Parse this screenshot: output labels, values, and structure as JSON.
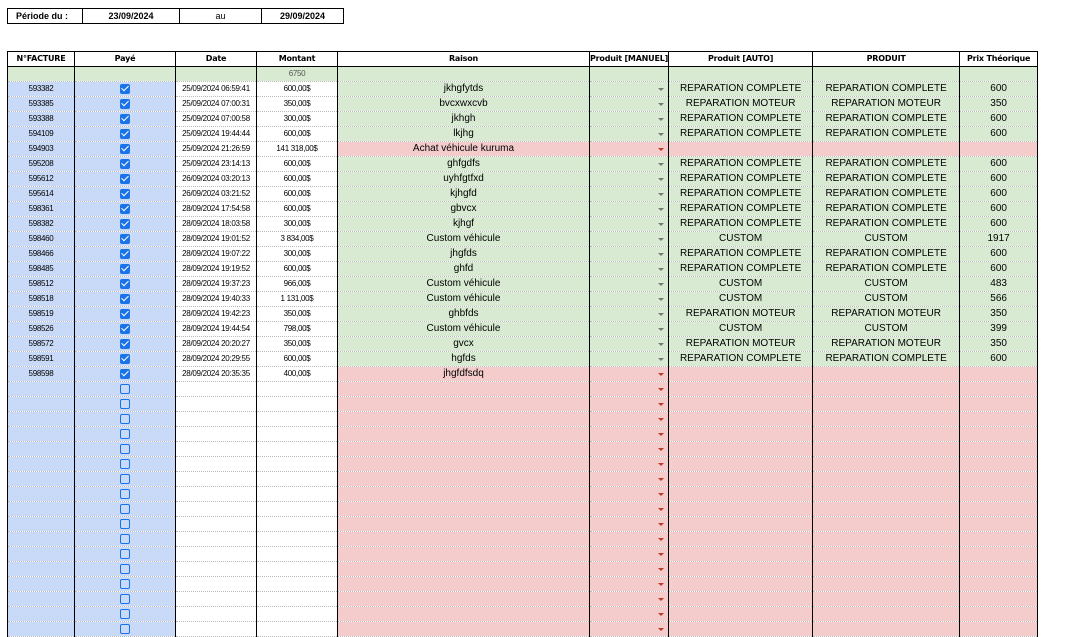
{
  "period": {
    "label": "Période du :",
    "start": "23/09/2024",
    "sep": "au",
    "end": "29/09/2024"
  },
  "headers": [
    "N°FACTURE",
    "Payé",
    "Date",
    "Montant",
    "Raison",
    "Produit [MANUEL]",
    "Produit [AUTO]",
    "PRODUIT",
    "Prix Théorique"
  ],
  "total": "6750",
  "rows": [
    {
      "id": "593382",
      "paid": true,
      "date": "25/09/2024 06:59:41",
      "amount": "600,00$",
      "reason": "jkhgfytds",
      "auto": "REPARATION COMPLETE",
      "product": "REPARATION COMPLETE",
      "price": "600",
      "status": "ok"
    },
    {
      "id": "593385",
      "paid": true,
      "date": "25/09/2024 07:00:31",
      "amount": "350,00$",
      "reason": "bvcxwxcvb",
      "auto": "REPARATION MOTEUR",
      "product": "REPARATION MOTEUR",
      "price": "350",
      "status": "ok"
    },
    {
      "id": "593388",
      "paid": true,
      "date": "25/09/2024 07:00:58",
      "amount": "300,00$",
      "reason": "jkhgh",
      "auto": "REPARATION COMPLETE",
      "product": "REPARATION COMPLETE",
      "price": "600",
      "status": "ok"
    },
    {
      "id": "594109",
      "paid": true,
      "date": "25/09/2024 19:44:44",
      "amount": "600,00$",
      "reason": "lkjhg",
      "auto": "REPARATION COMPLETE",
      "product": "REPARATION COMPLETE",
      "price": "600",
      "status": "ok"
    },
    {
      "id": "594903",
      "paid": true,
      "date": "25/09/2024 21:26:59",
      "amount": "141 318,00$",
      "reason": "Achat véhicule kuruma",
      "auto": "",
      "product": "",
      "price": "",
      "status": "err"
    },
    {
      "id": "595208",
      "paid": true,
      "date": "25/09/2024 23:14:13",
      "amount": "600,00$",
      "reason": "ghfgdfs",
      "auto": "REPARATION COMPLETE",
      "product": "REPARATION COMPLETE",
      "price": "600",
      "status": "ok"
    },
    {
      "id": "595612",
      "paid": true,
      "date": "26/09/2024 03:20:13",
      "amount": "600,00$",
      "reason": "uyhfgtfxd",
      "auto": "REPARATION COMPLETE",
      "product": "REPARATION COMPLETE",
      "price": "600",
      "status": "ok"
    },
    {
      "id": "595614",
      "paid": true,
      "date": "26/09/2024 03:21:52",
      "amount": "600,00$",
      "reason": "kjhgfd",
      "auto": "REPARATION COMPLETE",
      "product": "REPARATION COMPLETE",
      "price": "600",
      "status": "ok"
    },
    {
      "id": "598361",
      "paid": true,
      "date": "28/09/2024 17:54:58",
      "amount": "600,00$",
      "reason": "gbvcx",
      "auto": "REPARATION COMPLETE",
      "product": "REPARATION COMPLETE",
      "price": "600",
      "status": "ok"
    },
    {
      "id": "598382",
      "paid": true,
      "date": "28/09/2024 18:03:58",
      "amount": "300,00$",
      "reason": "kjhgf",
      "auto": "REPARATION COMPLETE",
      "product": "REPARATION COMPLETE",
      "price": "600",
      "status": "ok"
    },
    {
      "id": "598460",
      "paid": true,
      "date": "28/09/2024 19:01:52",
      "amount": "3 834,00$",
      "reason": "Custom véhicule",
      "auto": "CUSTOM",
      "product": "CUSTOM",
      "price": "1917",
      "status": "ok"
    },
    {
      "id": "598466",
      "paid": true,
      "date": "28/09/2024 19:07:22",
      "amount": "300,00$",
      "reason": "jhgfds",
      "auto": "REPARATION COMPLETE",
      "product": "REPARATION COMPLETE",
      "price": "600",
      "status": "ok"
    },
    {
      "id": "598485",
      "paid": true,
      "date": "28/09/2024 19:19:52",
      "amount": "600,00$",
      "reason": "ghfd",
      "auto": "REPARATION COMPLETE",
      "product": "REPARATION COMPLETE",
      "price": "600",
      "status": "ok"
    },
    {
      "id": "598512",
      "paid": true,
      "date": "28/09/2024 19:37:23",
      "amount": "966,00$",
      "reason": "Custom véhicule",
      "auto": "CUSTOM",
      "product": "CUSTOM",
      "price": "483",
      "status": "ok"
    },
    {
      "id": "598518",
      "paid": true,
      "date": "28/09/2024 19:40:33",
      "amount": "1 131,00$",
      "reason": "Custom véhicule",
      "auto": "CUSTOM",
      "product": "CUSTOM",
      "price": "566",
      "status": "ok"
    },
    {
      "id": "598519",
      "paid": true,
      "date": "28/09/2024 19:42:23",
      "amount": "350,00$",
      "reason": "ghbfds",
      "auto": "REPARATION MOTEUR",
      "product": "REPARATION MOTEUR",
      "price": "350",
      "status": "ok"
    },
    {
      "id": "598526",
      "paid": true,
      "date": "28/09/2024 19:44:54",
      "amount": "798,00$",
      "reason": "Custom véhicule",
      "auto": "CUSTOM",
      "product": "CUSTOM",
      "price": "399",
      "status": "ok"
    },
    {
      "id": "598572",
      "paid": true,
      "date": "28/09/2024 20:20:27",
      "amount": "350,00$",
      "reason": "gvcx",
      "auto": "REPARATION MOTEUR",
      "product": "REPARATION MOTEUR",
      "price": "350",
      "status": "ok"
    },
    {
      "id": "598591",
      "paid": true,
      "date": "28/09/2024 20:29:55",
      "amount": "600,00$",
      "reason": "hgfds",
      "auto": "REPARATION COMPLETE",
      "product": "REPARATION COMPLETE",
      "price": "600",
      "status": "ok"
    },
    {
      "id": "598598",
      "paid": true,
      "date": "28/09/2024 20:35:35",
      "amount": "400,00$",
      "reason": "jhgfdfsdq",
      "auto": "",
      "product": "",
      "price": "",
      "status": "err"
    }
  ],
  "empty_rows": 17,
  "colors": {
    "blue": "#c9daf8",
    "green": "#d9ead3",
    "red": "#f4cccc",
    "checkbox": "#1a73e8"
  }
}
